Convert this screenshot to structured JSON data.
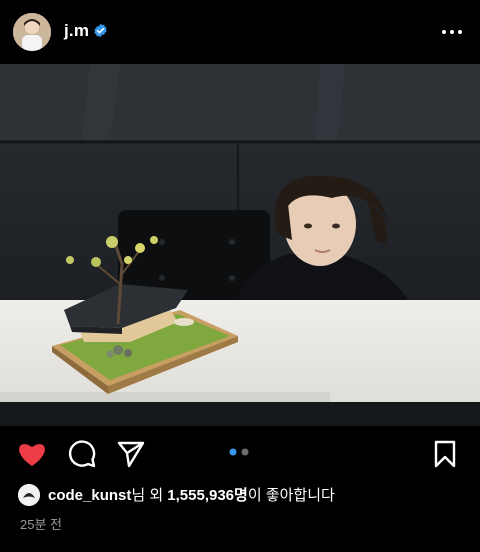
{
  "post": {
    "username": "j.m",
    "verified": true,
    "more_icon": "more-horizontal-icon",
    "likes": {
      "liker": "code_kunst",
      "middle": "님 외 ",
      "count": "1,555,936명",
      "suffix": "이 좋아합니다"
    },
    "time_ago": "25분 전",
    "carousel": {
      "total": 2,
      "active": 1
    }
  },
  "actions": {
    "like_icon": "heart-filled-icon",
    "comment_icon": "comment-icon",
    "share_icon": "send-icon",
    "save_icon": "bookmark-icon"
  },
  "colors": {
    "accent_like": "#ee3d49",
    "dot_active": "#3897f0",
    "dot_inactive": "#6b6b6b"
  }
}
